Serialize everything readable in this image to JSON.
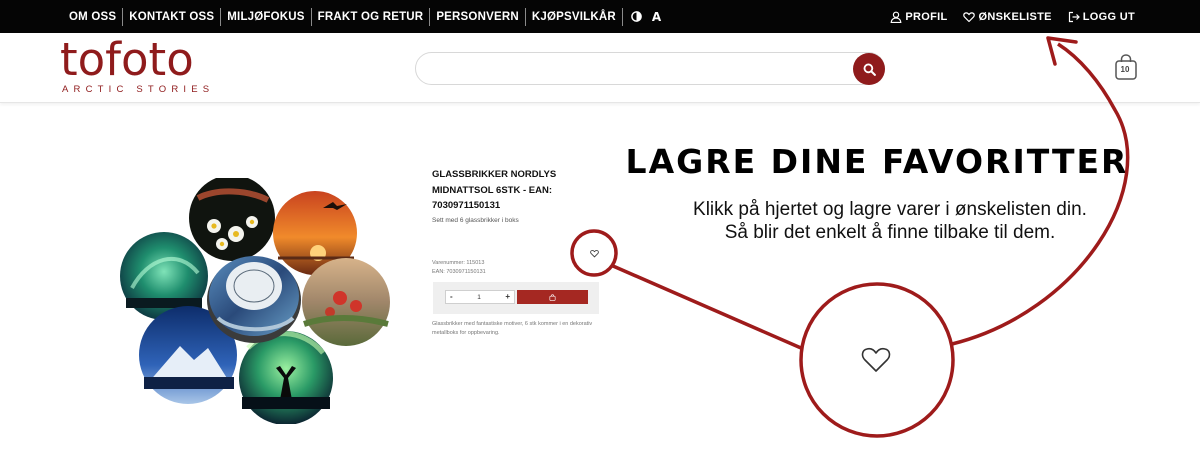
{
  "topnav": {
    "items": [
      "OM OSS",
      "KONTAKT OSS",
      "MILJØFOKUS",
      "FRAKT OG RETUR",
      "PERSONVERN",
      "KJØPSVILKÅR"
    ],
    "font_size_label": "A"
  },
  "usernav": {
    "profile": "PROFIL",
    "wishlist": "ØNSKELISTE",
    "logout": "LOGG UT"
  },
  "logo": {
    "word": "tofoto",
    "tagline": "ARCTIC STORIES"
  },
  "search": {
    "value": "",
    "placeholder": ""
  },
  "cart": {
    "count": "10"
  },
  "product": {
    "title": "GLASSBRIKKER NORDLYS MIDNATTSOL 6STK - EAN: 7030971150131",
    "subtitle": "Sett med 6 glassbrikker i boks",
    "item_number": "Varenummer: 115013",
    "ean": "EAN: 7030971150131",
    "quantity": "1",
    "minus": "-",
    "plus": "+",
    "description": "Glassbrikker med fantastiske motiver, 6 stk kommer i en dekorativ metallboks for oppbevaring."
  },
  "promo": {
    "title": "LAGRE DINE FAVORITTER",
    "line1": "Klikk på hjertet og lagre varer i ønskelisten din.",
    "line2": "Så blir det enkelt å finne tilbake til dem."
  },
  "colors": {
    "brand": "#8f1b1c",
    "topbar": "#050505",
    "annotation": "#9e1b1b",
    "add_to_cart": "#a52822"
  }
}
